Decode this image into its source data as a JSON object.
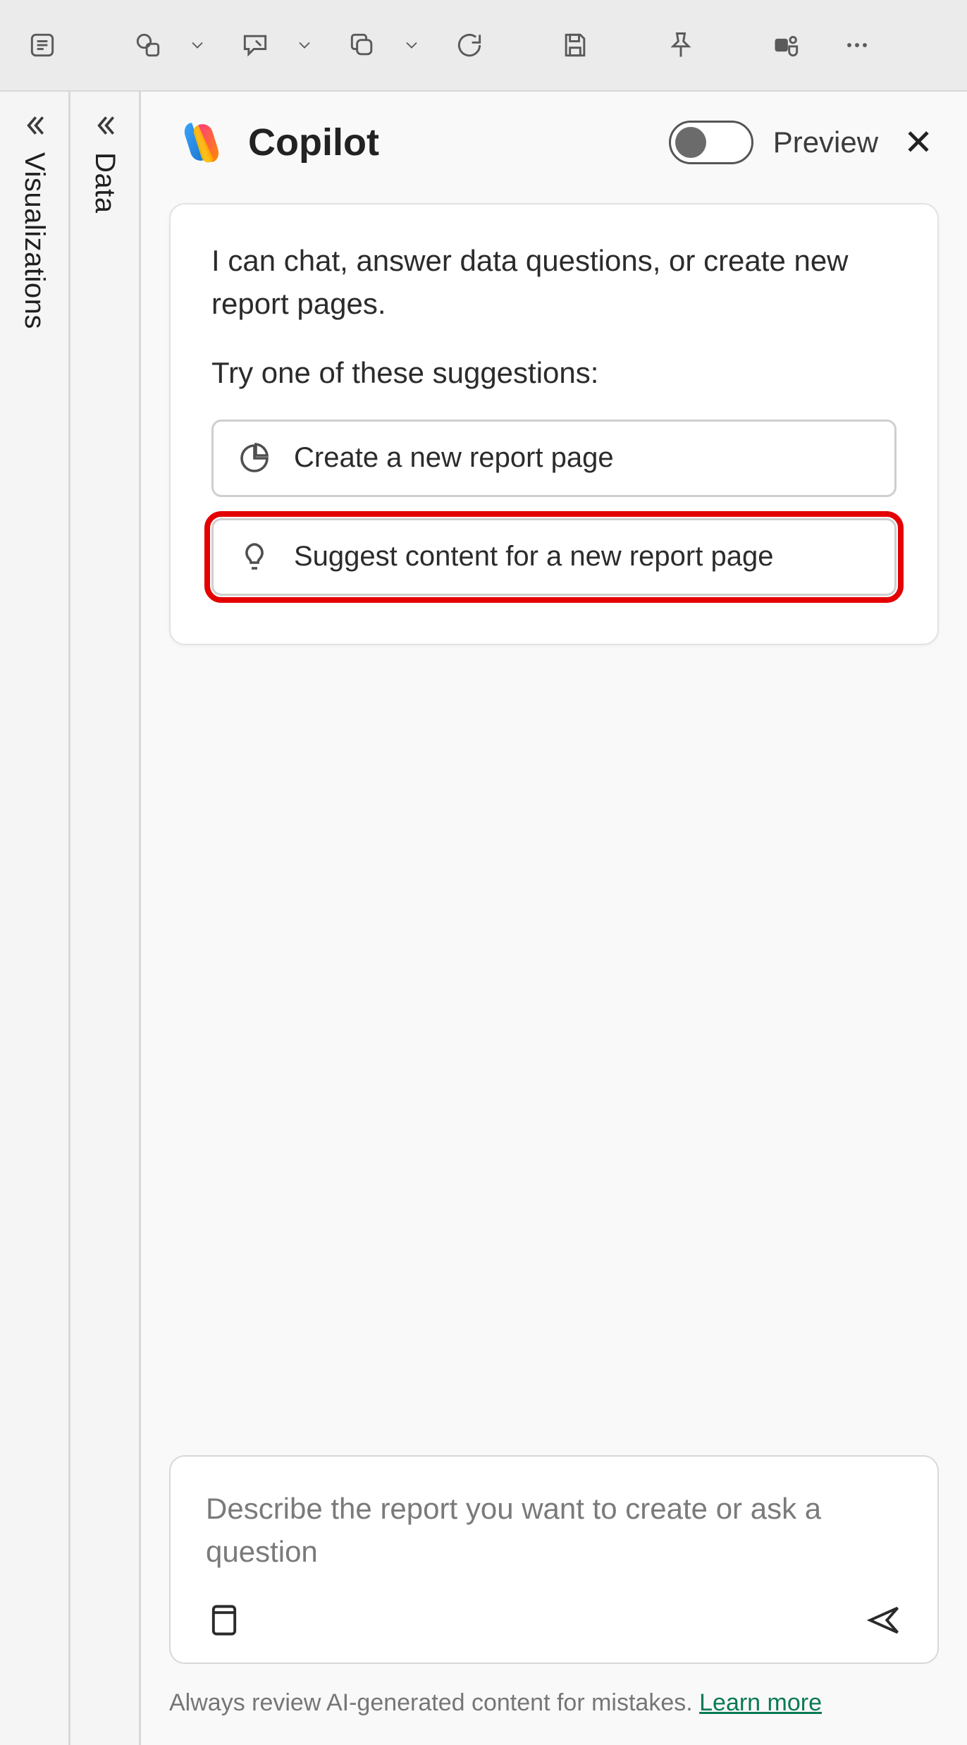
{
  "toolbar": {
    "icons": [
      "outline-panel-icon",
      "shapes-icon",
      "shapes-dropdown-icon",
      "comment-icon",
      "comment-dropdown-icon",
      "copy-icon",
      "copy-dropdown-icon",
      "refresh-icon",
      "save-icon",
      "pin-icon",
      "teams-icon",
      "more-icon"
    ]
  },
  "side_panels": {
    "visualizations_label": "Visualizations",
    "data_label": "Data"
  },
  "copilot": {
    "title": "Copilot",
    "preview_label": "Preview",
    "intro": "I can chat, answer data questions, or create new report pages.",
    "try_label": "Try one of these suggestions:",
    "suggestions": [
      {
        "icon": "piechart-icon",
        "label": "Create a new report page"
      },
      {
        "icon": "lightbulb-icon",
        "label": "Suggest content for a new report page",
        "highlighted": true
      }
    ],
    "prompt_placeholder": "Describe the report you want to create or ask a question",
    "footnote_text": "Always review AI-generated content for mistakes. ",
    "footnote_link": "Learn more"
  }
}
